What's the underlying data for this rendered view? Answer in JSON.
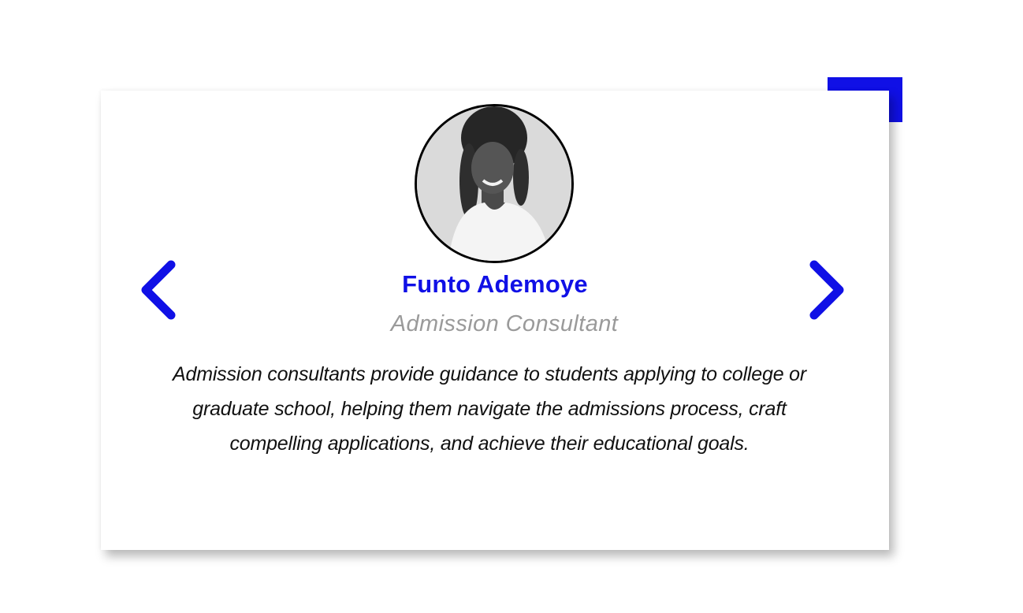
{
  "colors": {
    "accent": "#1010e6",
    "role_text": "#9a9a9a",
    "bio_text": "#111111",
    "card_bg": "#ffffff"
  },
  "testimonial": {
    "name": "Funto Ademoye",
    "role": "Admission Consultant",
    "bio": "Admission consultants provide guidance to students applying to college or graduate school, helping them navigate the admissions process, craft compelling applications, and achieve their educational goals.",
    "avatar_icon": "person-portrait-photo"
  },
  "navigation": {
    "prev_icon": "chevron-left-icon",
    "next_icon": "chevron-right-icon"
  }
}
